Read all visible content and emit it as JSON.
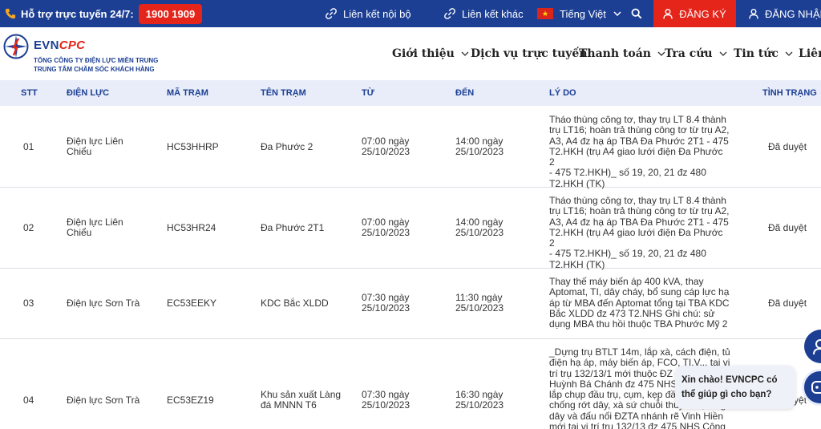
{
  "topbar": {
    "hotline_label": "Hỗ trợ trực tuyến 24/7:",
    "hotline_number": "1900 1909",
    "internal_links": "Liên kết nội bộ",
    "external_links": "Liên kết khác",
    "language": "Tiếng Việt",
    "register": "ĐĂNG KÝ",
    "login": "ĐĂNG NHẬP"
  },
  "header": {
    "brand_evn": "EVN",
    "brand_cpc": "CPC",
    "subtitle1": "TỔNG CÔNG TY ĐIỆN LỰC MIỀN TRUNG",
    "subtitle2": "TRUNG TÂM CHĂM SÓC KHÁCH HÀNG",
    "nav": [
      "Giới thiệu",
      "Dịch vụ trực tuyến",
      "Thanh toán",
      "Tra cứu",
      "Tin tức",
      "Liên"
    ]
  },
  "table": {
    "headers": [
      "STT",
      "ĐIỆN LỰC",
      "MÃ TRẠM",
      "TÊN TRẠM",
      "TỪ",
      "ĐẾN",
      "LÝ DO",
      "TÌNH TRẠNG"
    ],
    "rows": [
      {
        "stt": "01",
        "power_unit": [
          "Điện lực Liên",
          "Chiểu"
        ],
        "station_code": "HC53HHRP",
        "station_name": [
          "Đa Phước 2"
        ],
        "from": [
          "07:00 ngày",
          "25/10/2023"
        ],
        "to": [
          "14:00 ngày",
          "25/10/2023"
        ],
        "reason": [
          "Tháo thùng công tơ, thay trụ LT 8.4 thành",
          "trụ LT16; hoàn trả thùng công tơ từ trụ A2,",
          "A3, A4 đz hạ áp TBA Đa Phước 2T1 - 475",
          "T2.HKH (trụ A4 giao lưới điện Đa Phước 2",
          "- 475 T2.HKH)_ số 19, 20, 21 đz 480",
          "T2.HKH (TK)"
        ],
        "status": "Đã duyệt"
      },
      {
        "stt": "02",
        "power_unit": [
          "Điện lực Liên",
          "Chiểu"
        ],
        "station_code": "HC53HR24",
        "station_name": [
          "Đa Phước 2T1"
        ],
        "from": [
          "07:00 ngày",
          "25/10/2023"
        ],
        "to": [
          "14:00 ngày",
          "25/10/2023"
        ],
        "reason": [
          "Tháo thùng công tơ, thay trụ LT 8.4 thành",
          "trụ LT16; hoàn trả thùng công tơ từ trụ A2,",
          "A3, A4 đz hạ áp TBA Đa Phước 2T1 - 475",
          "T2.HKH (trụ A4 giao lưới điện Đa Phước 2",
          "- 475 T2.HKH)_ số 19, 20, 21 đz 480",
          "T2.HKH (TK)"
        ],
        "status": "Đã duyệt"
      },
      {
        "stt": "03",
        "power_unit": [
          "Điện lực Sơn Trà"
        ],
        "station_code": "EC53EEKY",
        "station_name": [
          "KDC Bắc XLDD"
        ],
        "from": [
          "07:30 ngày",
          "25/10/2023"
        ],
        "to": [
          "11:30 ngày",
          "25/10/2023"
        ],
        "reason": [
          "Thay thế máy biến áp 400 kVA, thay",
          "Aptomat, TI, dây cháy, bổ sung cáp lực hạ",
          "áp từ MBA đến Aptomat tổng tại TBA KDC",
          "Bắc XLDD đz 473 T2.NHS Ghi chú: sử",
          "dụng MBA thu hồi thuộc TBA Phước Mỹ 2"
        ],
        "status": "Đã duyệt"
      },
      {
        "stt": "04",
        "power_unit": [
          "Điện lực Sơn Trà"
        ],
        "station_code": "EC53EZ19",
        "station_name": [
          "Khu sản xuất Làng",
          "đá MNNN T6"
        ],
        "from": [
          "07:30 ngày",
          "25/10/2023"
        ],
        "to": [
          "16:30 ngày",
          "25/10/2023"
        ],
        "reason": [
          "_Dựng trụ BTLT 14m, lắp xà, cách điện, tủ",
          "điện hạ áp, máy biến áp, FCO, TI,V... tại vị",
          "trí trụ 132/13/1 mới thuộc ĐZ",
          "Huỳnh Bá Chánh đz 475 NHS",
          "lắp chụp đầu trụ, cụm, kẹp đầu",
          "chống rớt dây, xà sứ chuỗi thủy tinh, tăng",
          "dây và đấu nối ĐZTA nhánh rẽ Vinh Hiền",
          "mới tại vị trí trụ 132/13 đz 475 NHS Công"
        ],
        "status": "Đã duyệt"
      }
    ]
  },
  "chat": {
    "greeting_line1": "Xin chào! EVNCPC có",
    "greeting_line2": "thể giúp gì cho bạn?"
  },
  "colors": {
    "primary": "#1c3f94",
    "accent_red": "#e5241a",
    "table_header_bg": "#e8edf9"
  }
}
